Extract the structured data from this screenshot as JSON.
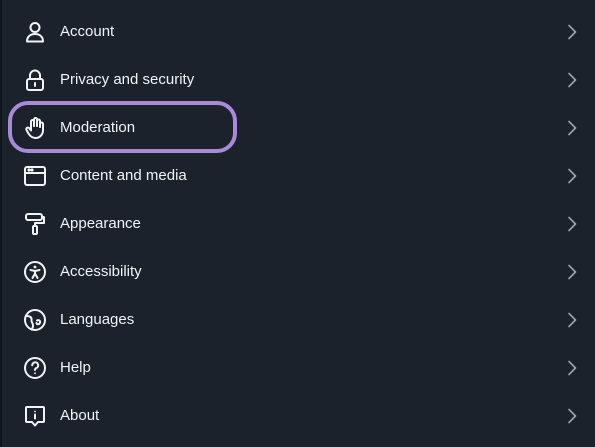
{
  "settings": {
    "items": [
      {
        "label": "Account",
        "icon": "person-icon"
      },
      {
        "label": "Privacy and security",
        "icon": "lock-icon"
      },
      {
        "label": "Moderation",
        "icon": "hand-icon"
      },
      {
        "label": "Content and media",
        "icon": "browser-window-icon"
      },
      {
        "label": "Appearance",
        "icon": "paint-roller-icon"
      },
      {
        "label": "Accessibility",
        "icon": "accessibility-icon"
      },
      {
        "label": "Languages",
        "icon": "globe-icon"
      },
      {
        "label": "Help",
        "icon": "question-circle-icon"
      },
      {
        "label": "About",
        "icon": "info-speech-bubble-icon"
      }
    ],
    "highlighted_item": "Moderation"
  },
  "colors": {
    "background": "#1b222c",
    "text": "#f1f3f5",
    "icon": "#f1f3f5",
    "chevron": "#9aa4b0",
    "highlight_ring": "#a98ad8"
  }
}
